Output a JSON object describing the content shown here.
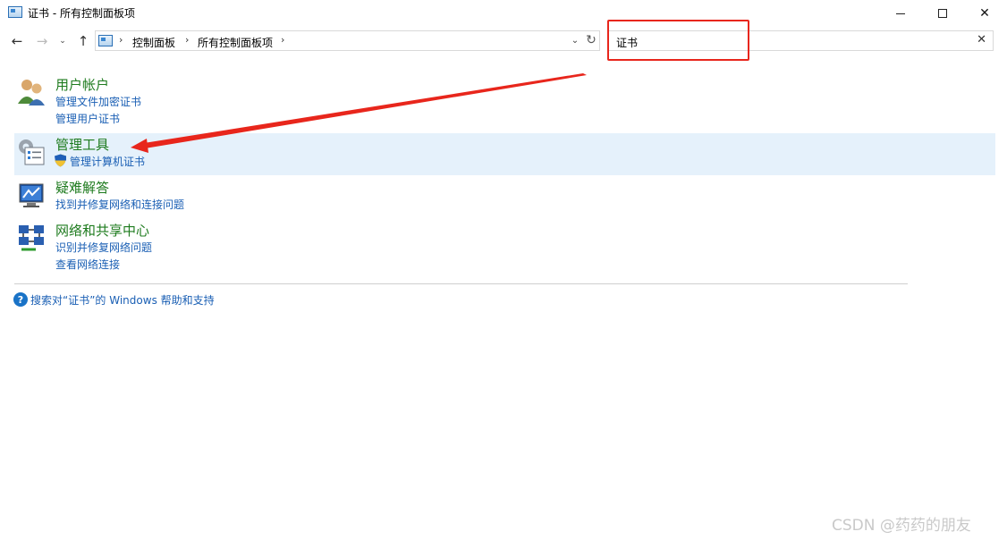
{
  "window": {
    "title": "证书 - 所有控制面板项",
    "minimize_icon": "minimize-icon",
    "maximize_icon": "maximize-icon",
    "close_label": "✕"
  },
  "nav": {
    "back_label": "←",
    "forward_label": "→",
    "recent_label": "⌄",
    "up_label": "↑",
    "breadcrumbs": [
      "控制面板",
      "所有控制面板项"
    ],
    "breadcrumb_sep": "›",
    "dropdown_label": "⌄",
    "refresh_label": "↻"
  },
  "search": {
    "value": "证书",
    "clear_label": "✕"
  },
  "results": [
    {
      "title": "用户帐户",
      "icon": "user-accounts-icon",
      "links": [
        "管理文件加密证书",
        "管理用户证书"
      ]
    },
    {
      "title": "管理工具",
      "icon": "admin-tools-icon",
      "links": [
        "管理计算机证书"
      ],
      "selected": true
    },
    {
      "title": "疑难解答",
      "icon": "troubleshooting-icon",
      "links": [
        "找到并修复网络和连接问题"
      ]
    },
    {
      "title": "网络和共享中心",
      "icon": "network-center-icon",
      "links": [
        "识别并修复网络问题",
        "查看网络连接"
      ]
    }
  ],
  "help": {
    "icon_label": "?",
    "text": "搜索对“证书”的 Windows 帮助和支持"
  },
  "watermark": "CSDN @药药的朋友",
  "colors": {
    "accent_red": "#e8261c",
    "title_green": "#1e7b1e",
    "link_blue": "#1a5fb4",
    "selected_bg": "#e5f1fb"
  }
}
